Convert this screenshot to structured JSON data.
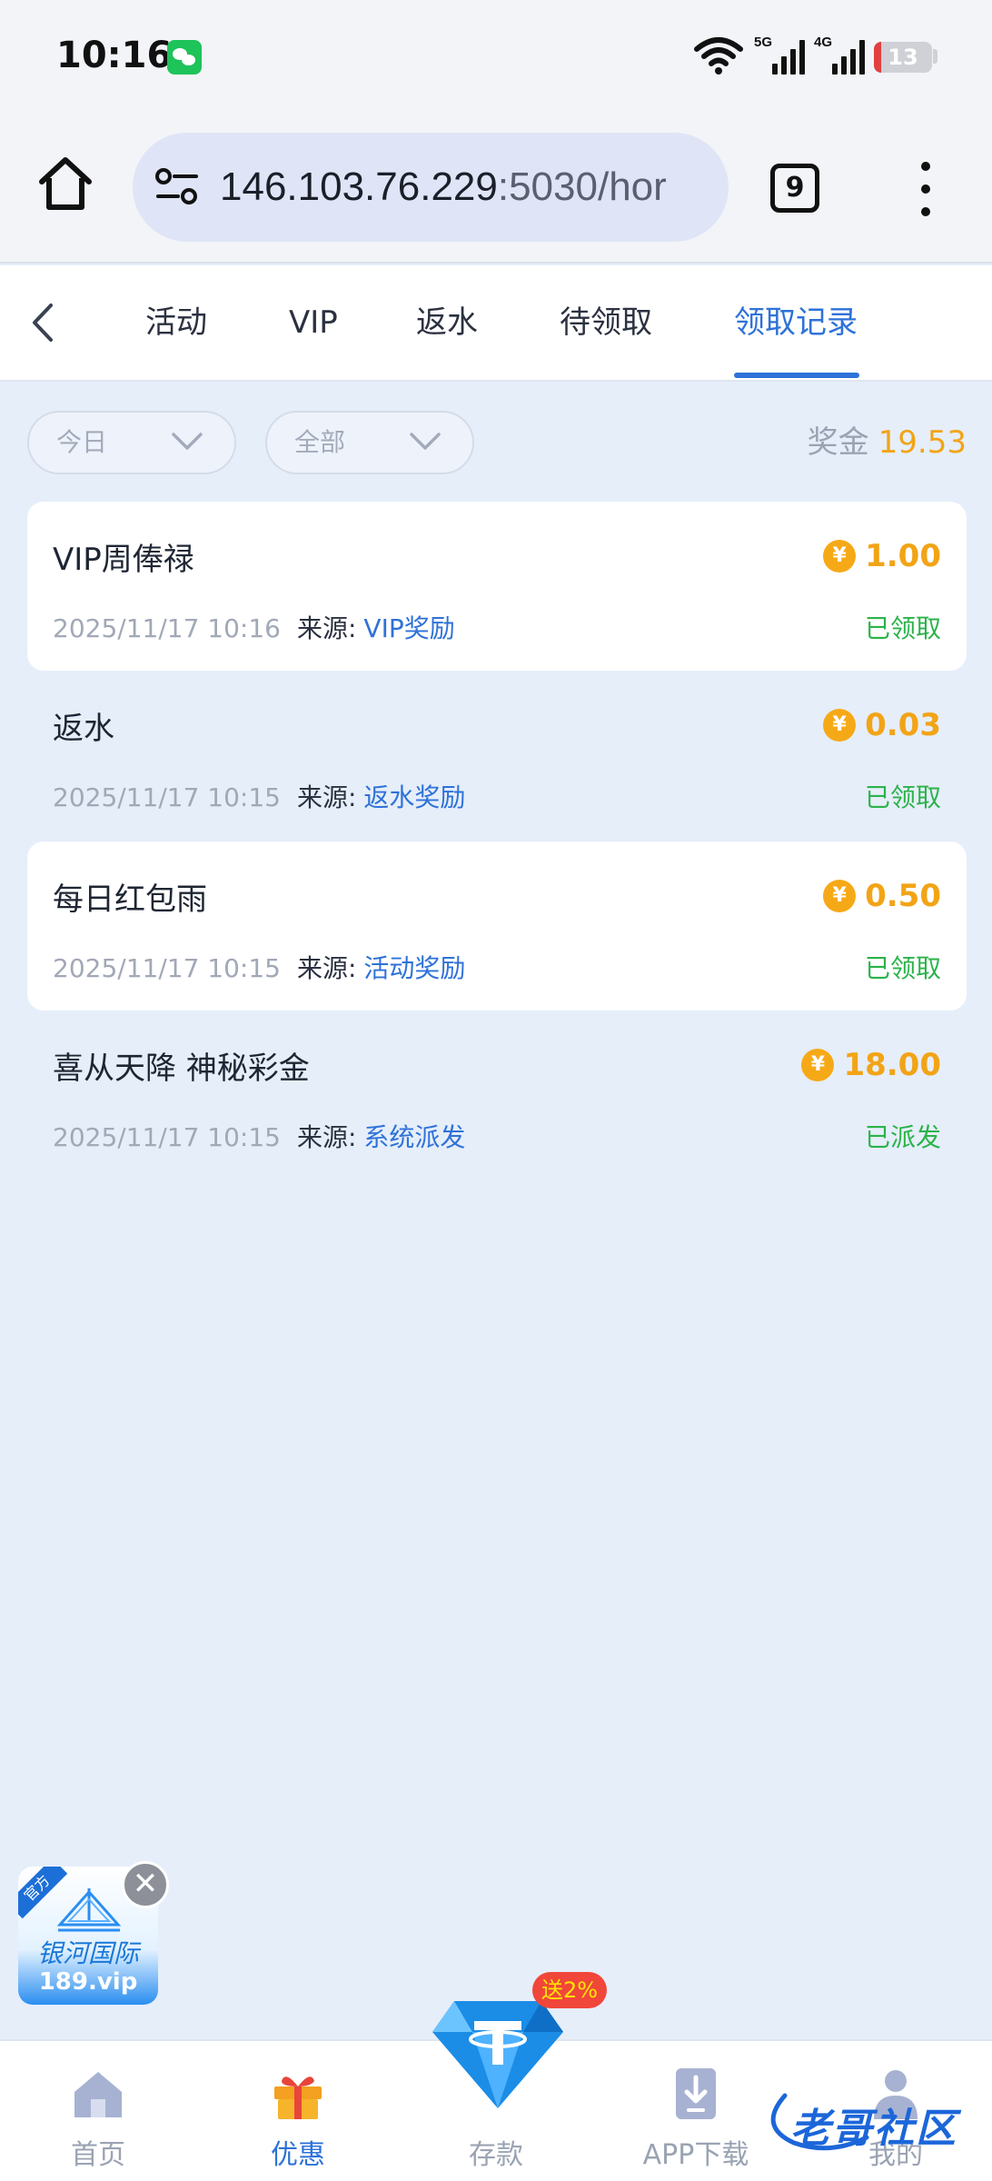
{
  "status_bar": {
    "time": "10:16",
    "network_1": "5G",
    "network_2": "4G",
    "battery": "13"
  },
  "browser": {
    "url_host": "146.103.76.229",
    "url_rest": ":5030/hor",
    "tab_count": "9"
  },
  "tabs": [
    {
      "label": "活动"
    },
    {
      "label": "VIP"
    },
    {
      "label": "返水"
    },
    {
      "label": "待领取"
    },
    {
      "label": "领取记录",
      "active": true
    }
  ],
  "filters": {
    "date": "今日",
    "type": "全部"
  },
  "bonus": {
    "label": "奖金",
    "value": "19.53"
  },
  "records": [
    {
      "title": "VIP周俸禄",
      "amount": "1.00",
      "time": "2025/11/17 10:16",
      "source_label": "来源:",
      "source": "VIP奖励",
      "status": "已领取"
    },
    {
      "title": "返水",
      "amount": "0.03",
      "time": "2025/11/17 10:15",
      "source_label": "来源:",
      "source": "返水奖励",
      "status": "已领取"
    },
    {
      "title": "每日红包雨",
      "amount": "0.50",
      "time": "2025/11/17 10:15",
      "source_label": "来源:",
      "source": "活动奖励",
      "status": "已领取"
    },
    {
      "title": "喜从天降 神秘彩金",
      "amount": "18.00",
      "time": "2025/11/17 10:15",
      "source_label": "来源:",
      "source": "系统派发",
      "status": "已派发"
    }
  ],
  "coin_symbol": "¥",
  "ad": {
    "ribbon": "官方",
    "brand": "银河国际",
    "domain": "189.vip",
    "close": "✕"
  },
  "bottom_nav": [
    {
      "label": "首页"
    },
    {
      "label": "优惠",
      "active": true
    },
    {
      "label": "存款"
    },
    {
      "label": "APP下载"
    },
    {
      "label": "我的"
    }
  ],
  "promo": "送2%",
  "watermark": "老哥社区",
  "colors": {
    "accent": "#2e72d8",
    "gold": "#f2a417",
    "success": "#2bb34a",
    "background": "#e6eefa"
  }
}
